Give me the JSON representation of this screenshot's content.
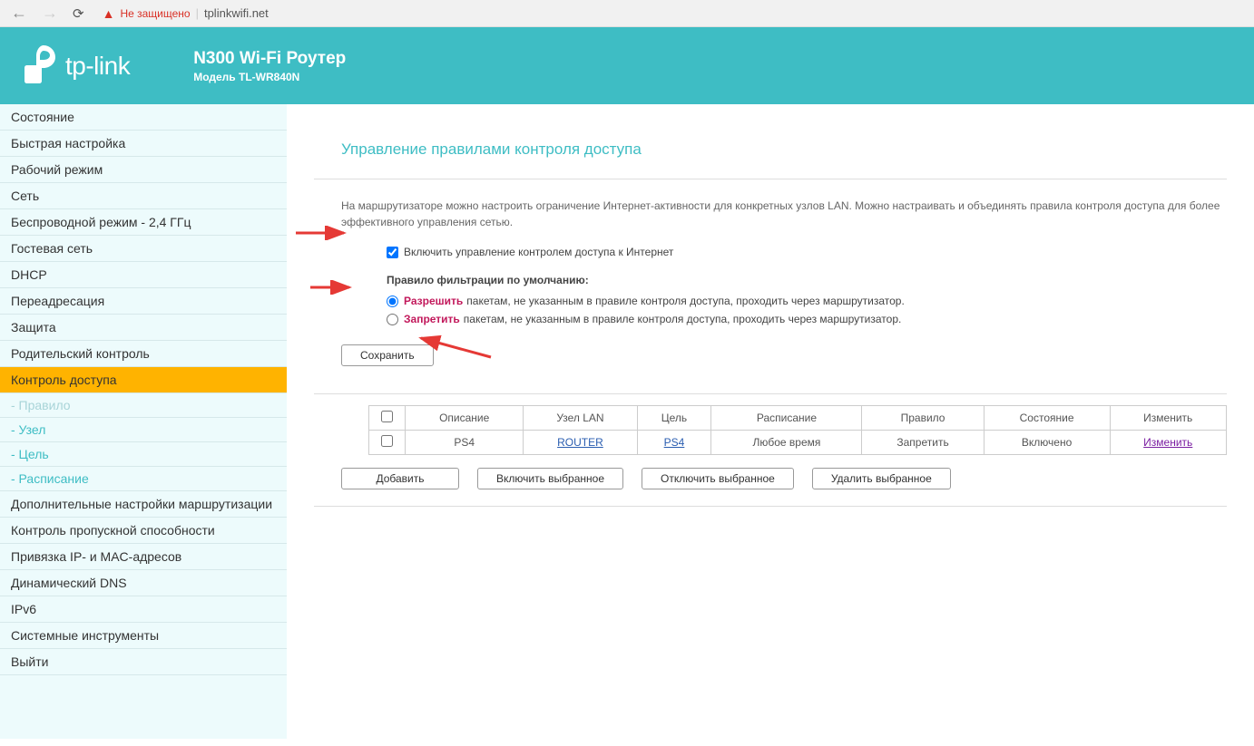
{
  "browser": {
    "insecure_label": "Не защищено",
    "url": "tplinkwifi.net"
  },
  "header": {
    "logo_text": "tp-link",
    "product_title": "N300 Wi-Fi Роутер",
    "product_model": "Модель TL-WR840N"
  },
  "sidebar": {
    "items": [
      {
        "label": "Состояние",
        "sub": false
      },
      {
        "label": "Быстрая настройка",
        "sub": false
      },
      {
        "label": "Рабочий режим",
        "sub": false
      },
      {
        "label": "Сеть",
        "sub": false
      },
      {
        "label": "Беспроводной режим - 2,4 ГГц",
        "sub": false
      },
      {
        "label": "Гостевая сеть",
        "sub": false
      },
      {
        "label": "DHCP",
        "sub": false
      },
      {
        "label": "Переадресация",
        "sub": false
      },
      {
        "label": "Защита",
        "sub": false
      },
      {
        "label": "Родительский контроль",
        "sub": false
      },
      {
        "label": "Контроль доступа",
        "sub": false,
        "active": true
      },
      {
        "label": "- Правило",
        "sub": true,
        "subactive": true
      },
      {
        "label": "- Узел",
        "sub": true
      },
      {
        "label": "- Цель",
        "sub": true
      },
      {
        "label": "- Расписание",
        "sub": true
      },
      {
        "label": "Дополнительные настройки маршрутизации",
        "sub": false
      },
      {
        "label": "Контроль пропускной способности",
        "sub": false
      },
      {
        "label": "Привязка IP- и MAC-адресов",
        "sub": false
      },
      {
        "label": "Динамический DNS",
        "sub": false
      },
      {
        "label": "IPv6",
        "sub": false
      },
      {
        "label": "Системные инструменты",
        "sub": false
      },
      {
        "label": "Выйти",
        "sub": false
      }
    ]
  },
  "content": {
    "title": "Управление правилами контроля доступа",
    "description": "На маршрутизаторе можно настроить ограничение Интернет-активности для конкретных узлов LAN. Можно настраивать и объединять правила контроля доступа для более эффективного управления сетью.",
    "enable_label": "Включить управление контролем доступа к Интернет",
    "filter_header": "Правило фильтрации по умолчанию:",
    "allow_word": "Разрешить",
    "allow_rest": "пакетам, не указанным в правиле контроля доступа, проходить через маршрутизатор.",
    "deny_word": "Запретить",
    "deny_rest": "пакетам, не указанным в правиле контроля доступа, проходить через маршрутизатор.",
    "save_btn": "Сохранить",
    "table": {
      "headers": [
        "",
        "Описание",
        "Узел LAN",
        "Цель",
        "Расписание",
        "Правило",
        "Состояние",
        "Изменить"
      ],
      "row": {
        "desc": "PS4",
        "host": "ROUTER",
        "target": "PS4",
        "schedule": "Любое время",
        "rule": "Запретить",
        "state": "Включено",
        "edit": "Изменить"
      }
    },
    "actions": {
      "add": "Добавить",
      "enable": "Включить выбранное",
      "disable": "Отключить выбранное",
      "delete": "Удалить выбранное"
    }
  }
}
